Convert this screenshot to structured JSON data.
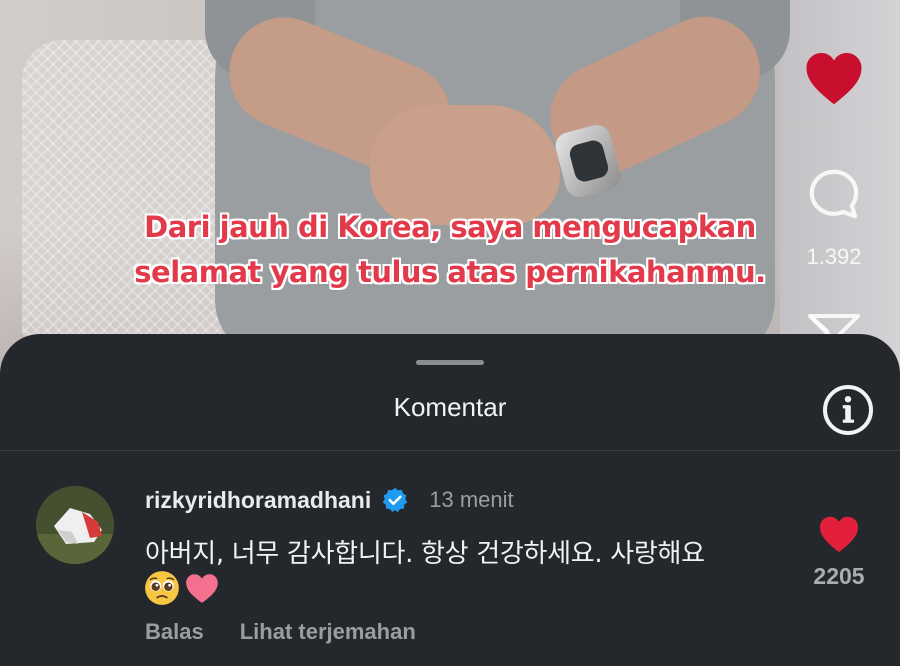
{
  "video": {
    "subtitle_line1": "Dari jauh di Korea, saya mengucapkan",
    "subtitle_line2": "selamat yang tulus atas pernikahanmu.",
    "comment_count": "1.392",
    "icons": [
      "heart-icon",
      "comment-bubble-icon",
      "share-icon"
    ],
    "heart_color": "#c8102e",
    "subtitle_color": "#e23a4a"
  },
  "sheet": {
    "title": "Komentar",
    "info_icon": "info-icon"
  },
  "comment": {
    "username": "rizkyridhoramadhani",
    "verified_icon": "verified-badge-icon",
    "verified_color": "#1d9bf0",
    "time": "13 menit",
    "text": "아버지, 너무 감사합니다. 항상 건강하세요. 사랑해요",
    "emojis": [
      "pleading-face-icon",
      "pink-heart-icon"
    ],
    "reply_label": "Balas",
    "translate_label": "Lihat terjemahan",
    "like_icon": "heart-icon",
    "like_color": "#e3203c",
    "like_count": "2205"
  }
}
